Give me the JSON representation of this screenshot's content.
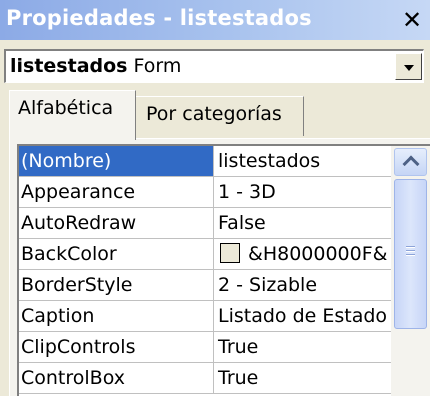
{
  "window": {
    "title": "Propiedades - listestados",
    "close_glyph": "✕"
  },
  "object_selector": {
    "name": "listestados",
    "type": "Form"
  },
  "tabs": [
    {
      "label": "Alfabética",
      "active": true
    },
    {
      "label": "Por categorías",
      "active": false
    }
  ],
  "properties": [
    {
      "name": "(Nombre)",
      "value": "listestados",
      "selected": true
    },
    {
      "name": "Appearance",
      "value": "1 - 3D"
    },
    {
      "name": "AutoRedraw",
      "value": "False"
    },
    {
      "name": "BackColor",
      "value": "&H8000000F&",
      "swatch_color": "#ECE9D8"
    },
    {
      "name": "BorderStyle",
      "value": "2 - Sizable"
    },
    {
      "name": "Caption",
      "value": "Listado de Estado"
    },
    {
      "name": "ClipControls",
      "value": "True"
    },
    {
      "name": "ControlBox",
      "value": "True"
    }
  ],
  "colors": {
    "selection": "#316AC5",
    "titlebar_start": "#8CAAE6",
    "window_bg": "#ECE9D8"
  }
}
